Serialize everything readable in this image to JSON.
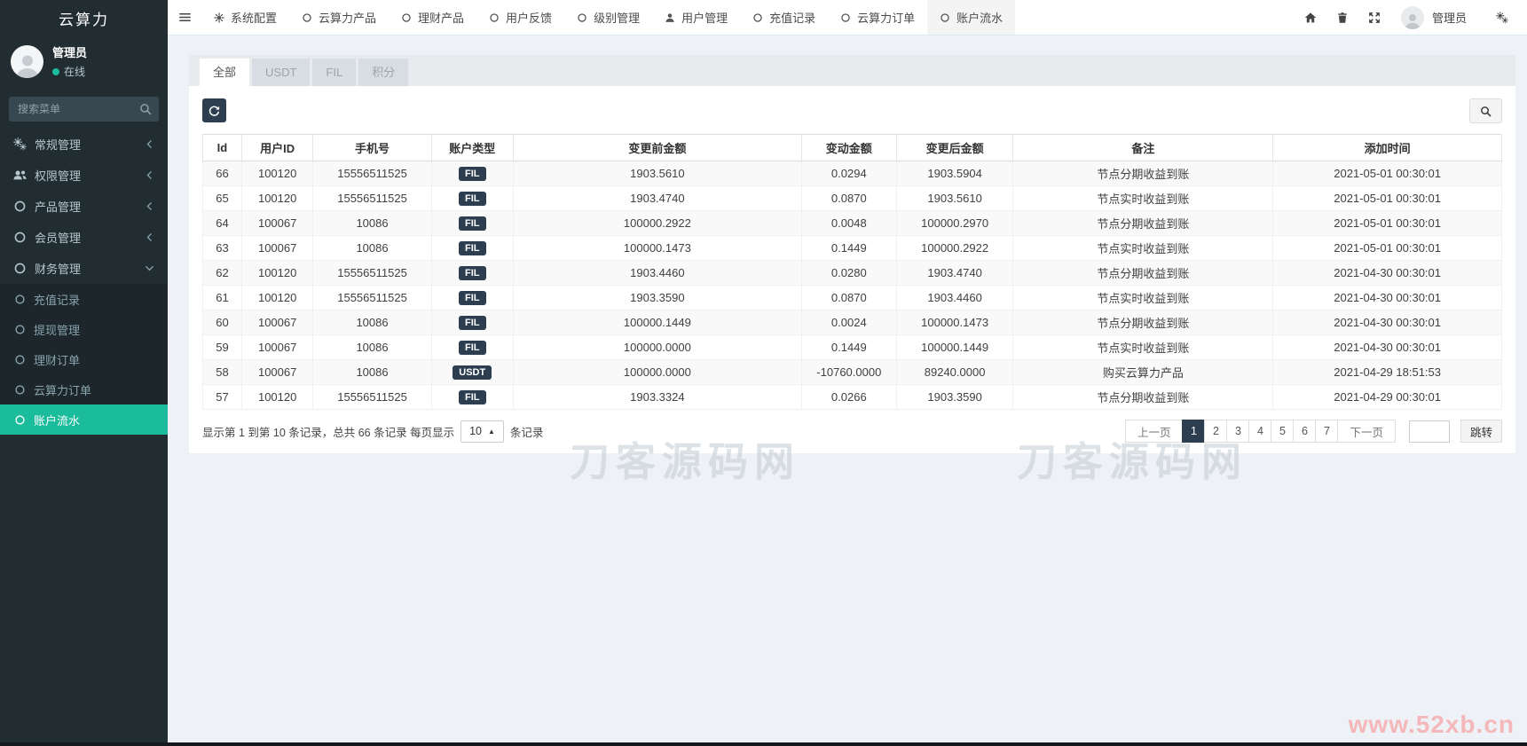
{
  "logo": "云算力",
  "sidebar": {
    "user_name": "管理员",
    "user_status": "在线",
    "search_placeholder": "搜索菜单",
    "menu": [
      {
        "label": "常规管理",
        "icon": "cogs",
        "chevron": "left",
        "expanded": false
      },
      {
        "label": "权限管理",
        "icon": "users",
        "chevron": "left",
        "expanded": false
      },
      {
        "label": "产品管理",
        "icon": "circle",
        "chevron": "left",
        "expanded": false
      },
      {
        "label": "会员管理",
        "icon": "circle",
        "chevron": "left",
        "expanded": false
      },
      {
        "label": "财务管理",
        "icon": "circle",
        "chevron": "down",
        "expanded": true
      }
    ],
    "submenu": [
      {
        "label": "充值记录",
        "active": false
      },
      {
        "label": "提现管理",
        "active": false
      },
      {
        "label": "理财订单",
        "active": false
      },
      {
        "label": "云算力订单",
        "active": false
      },
      {
        "label": "账户流水",
        "active": true
      }
    ]
  },
  "topnav": {
    "items": [
      {
        "label": "系统配置",
        "icon": "gear",
        "active": false
      },
      {
        "label": "云算力产品",
        "icon": "circle",
        "active": false
      },
      {
        "label": "理财产品",
        "icon": "circle",
        "active": false
      },
      {
        "label": "用户反馈",
        "icon": "circle",
        "active": false
      },
      {
        "label": "级别管理",
        "icon": "circle",
        "active": false
      },
      {
        "label": "用户管理",
        "icon": "user",
        "active": false
      },
      {
        "label": "充值记录",
        "icon": "circle",
        "active": false
      },
      {
        "label": "云算力订单",
        "icon": "circle",
        "active": false
      },
      {
        "label": "账户流水",
        "icon": "circle",
        "active": true
      }
    ],
    "admin_name": "管理员"
  },
  "filter_tabs": [
    {
      "label": "全部",
      "active": true
    },
    {
      "label": "USDT",
      "active": false
    },
    {
      "label": "FIL",
      "active": false
    },
    {
      "label": "积分",
      "active": false
    }
  ],
  "table": {
    "columns": [
      "Id",
      "用户ID",
      "手机号",
      "账户类型",
      "变更前金额",
      "变动金额",
      "变更后金额",
      "备注",
      "添加时间"
    ],
    "rows": [
      {
        "id": "66",
        "user_id": "100120",
        "phone": "15556511525",
        "type": "FIL",
        "before": "1903.5610",
        "change": "0.0294",
        "after": "1903.5904",
        "remark": "节点分期收益到账",
        "time": "2021-05-01 00:30:01"
      },
      {
        "id": "65",
        "user_id": "100120",
        "phone": "15556511525",
        "type": "FIL",
        "before": "1903.4740",
        "change": "0.0870",
        "after": "1903.5610",
        "remark": "节点实时收益到账",
        "time": "2021-05-01 00:30:01"
      },
      {
        "id": "64",
        "user_id": "100067",
        "phone": "10086",
        "type": "FIL",
        "before": "100000.2922",
        "change": "0.0048",
        "after": "100000.2970",
        "remark": "节点分期收益到账",
        "time": "2021-05-01 00:30:01"
      },
      {
        "id": "63",
        "user_id": "100067",
        "phone": "10086",
        "type": "FIL",
        "before": "100000.1473",
        "change": "0.1449",
        "after": "100000.2922",
        "remark": "节点实时收益到账",
        "time": "2021-05-01 00:30:01"
      },
      {
        "id": "62",
        "user_id": "100120",
        "phone": "15556511525",
        "type": "FIL",
        "before": "1903.4460",
        "change": "0.0280",
        "after": "1903.4740",
        "remark": "节点分期收益到账",
        "time": "2021-04-30 00:30:01"
      },
      {
        "id": "61",
        "user_id": "100120",
        "phone": "15556511525",
        "type": "FIL",
        "before": "1903.3590",
        "change": "0.0870",
        "after": "1903.4460",
        "remark": "节点实时收益到账",
        "time": "2021-04-30 00:30:01"
      },
      {
        "id": "60",
        "user_id": "100067",
        "phone": "10086",
        "type": "FIL",
        "before": "100000.1449",
        "change": "0.0024",
        "after": "100000.1473",
        "remark": "节点分期收益到账",
        "time": "2021-04-30 00:30:01"
      },
      {
        "id": "59",
        "user_id": "100067",
        "phone": "10086",
        "type": "FIL",
        "before": "100000.0000",
        "change": "0.1449",
        "after": "100000.1449",
        "remark": "节点实时收益到账",
        "time": "2021-04-30 00:30:01"
      },
      {
        "id": "58",
        "user_id": "100067",
        "phone": "10086",
        "type": "USDT",
        "before": "100000.0000",
        "change": "-10760.0000",
        "after": "89240.0000",
        "remark": "购买云算力产品",
        "time": "2021-04-29 18:51:53"
      },
      {
        "id": "57",
        "user_id": "100120",
        "phone": "15556511525",
        "type": "FIL",
        "before": "1903.3324",
        "change": "0.0266",
        "after": "1903.3590",
        "remark": "节点分期收益到账",
        "time": "2021-04-29 00:30:01"
      }
    ]
  },
  "pagination": {
    "info_prefix": "显示第 1 到第 10 条记录，总共 66 条记录 每页显示",
    "info_suffix": "条记录",
    "page_size": "10",
    "prev": "上一页",
    "next": "下一页",
    "pages": [
      "1",
      "2",
      "3",
      "4",
      "5",
      "6",
      "7"
    ],
    "active_page": "1",
    "jump": "跳转",
    "jump_input_value": ""
  },
  "watermark_center": "刀客源码网",
  "watermark_corner": "www.52xb.cn",
  "colors": {
    "accent": "#1abc9c",
    "dark": "#2c3e50",
    "sidebar_bg": "#222d32",
    "corner_watermark": "#f4b8ba"
  }
}
